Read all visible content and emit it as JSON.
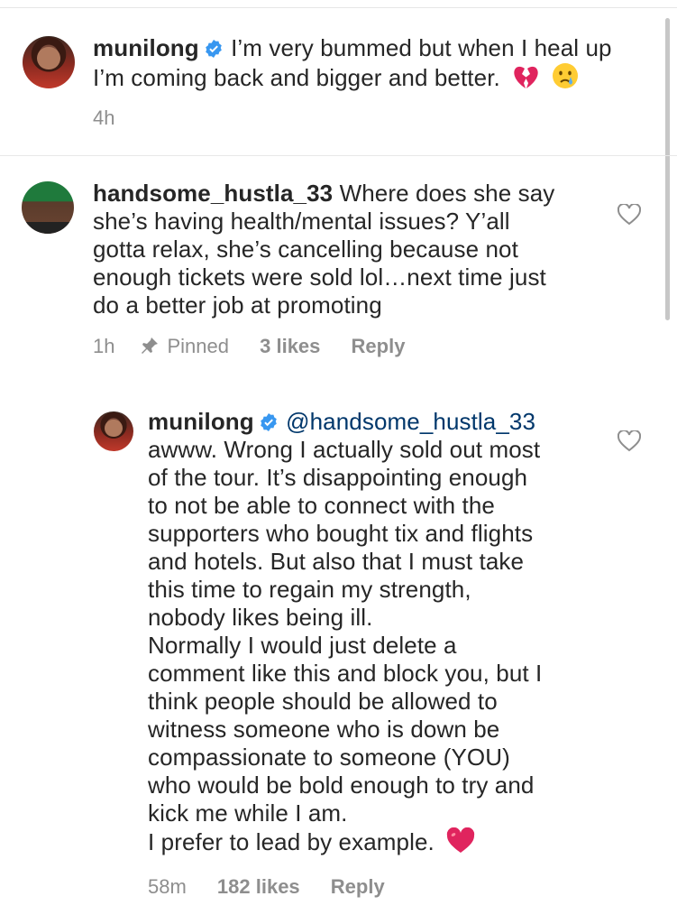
{
  "comments": [
    {
      "username": "munilong",
      "verified": true,
      "text_lines": [
        "I’m very bummed but when I heal up",
        "I’m coming back and bigger and better."
      ],
      "emojis": [
        "broken-heart-emoji",
        "crying-face-emoji"
      ],
      "time": "4h"
    },
    {
      "username": "handsome_hustla_33",
      "verified": false,
      "first_line_text": "Where does she say",
      "text_lines": [
        "she’s having health/mental issues? Y’all",
        "gotta relax, she’s cancelling because not",
        "enough tickets were sold lol…next time just",
        "do a better job at promoting"
      ],
      "time": "1h",
      "pinned_label": "Pinned",
      "likes": "3 likes",
      "reply_label": "Reply"
    }
  ],
  "reply": {
    "username": "munilong",
    "verified": true,
    "mention": "@handsome_hustla_33",
    "text_lines": [
      "awww. Wrong I actually sold out most",
      "of the tour. It’s disappointing enough",
      "to not be able to connect with the",
      "supporters who bought tix and flights",
      "and hotels. But also that I must take",
      "this time to regain my strength,",
      "nobody likes being ill.",
      "Normally I would just delete a",
      "comment like this and block you, but I",
      "think people should be allowed to",
      "witness someone who is down be",
      "compassionate to someone (YOU)",
      "who would be bold enough to try and",
      "kick me while I am.",
      "I prefer to lead by example."
    ],
    "emoji": "red-heart-emoji",
    "time": "58m",
    "likes": "182 likes",
    "reply_label": "Reply"
  },
  "colors": {
    "text": "#262626",
    "meta": "#8e8e8e",
    "verified_badge": "#3897f0",
    "mention": "#00376b",
    "heart_emoji": "#e0245e"
  }
}
